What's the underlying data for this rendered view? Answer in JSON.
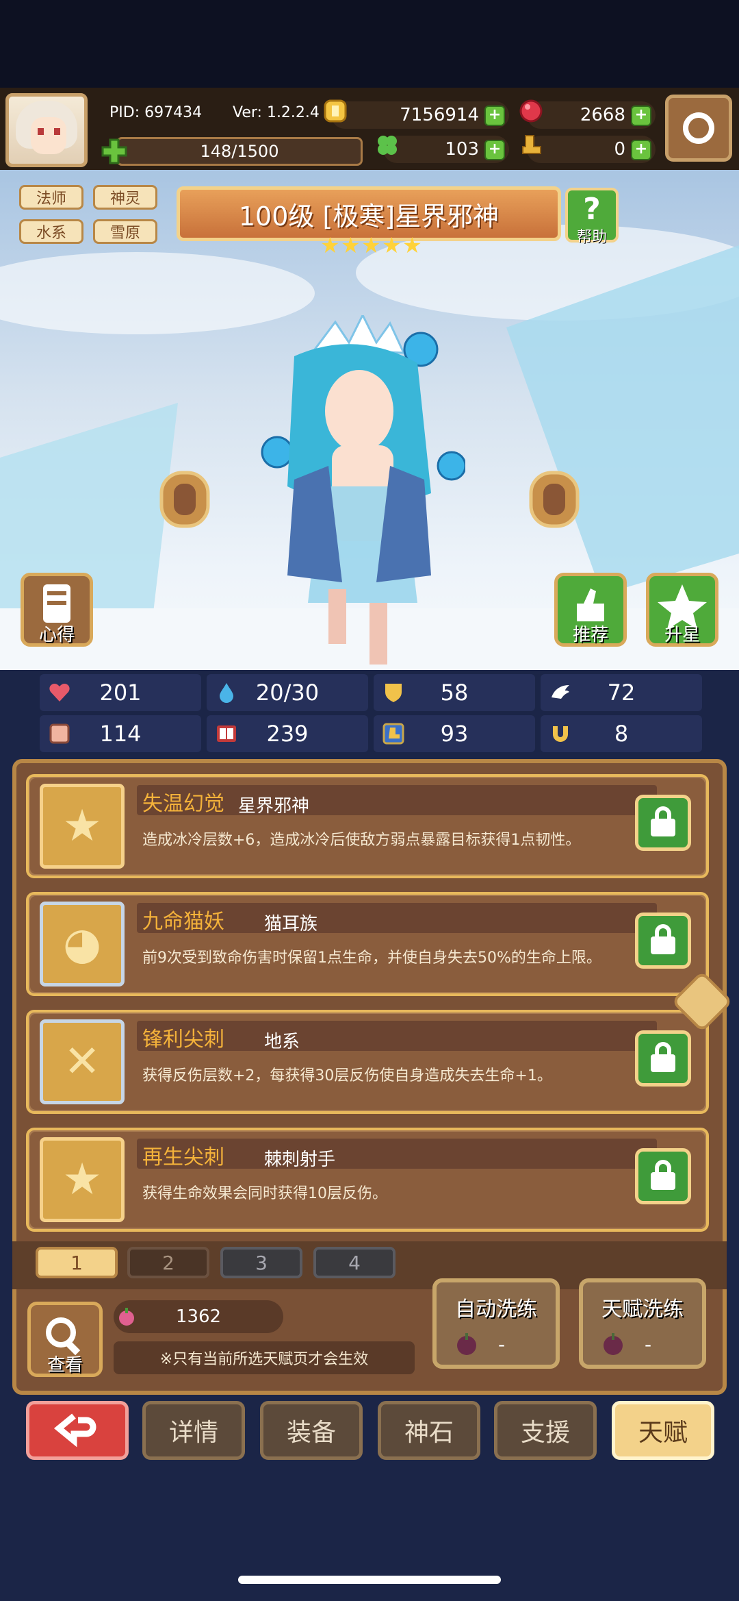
{
  "header": {
    "pid": "PID: 697434",
    "version": "Ver: 1.2.2.4",
    "gold": "7156914",
    "gems": "2668",
    "stamina": "148/1500",
    "clover": "103",
    "boots": "0"
  },
  "hero": {
    "tags": [
      "法师",
      "神灵",
      "水系",
      "雪原"
    ],
    "title": "100级 [极寒]星界邪神",
    "stars": 5,
    "help_label": "帮助",
    "left_button": "心得",
    "recommend_button": "推荐",
    "upgrade_button": "升星"
  },
  "stats": {
    "hp": "201",
    "mana": "20/30",
    "defense": "58",
    "speed": "72",
    "attack": "114",
    "magic": "239",
    "armor": "93",
    "luck": "8"
  },
  "talents": [
    {
      "name": "失温幻觉",
      "source": "星界邪神",
      "desc": "造成冰冷层数+6，造成冰冷后使敌方弱点暴露目标获得1点韧性。",
      "icon": "star-icon"
    },
    {
      "name": "九命猫妖",
      "source": "猫耳族",
      "desc": "前9次受到致命伤害时保留1点生命，并使自身失去50%的生命上限。",
      "icon": "cat-icon"
    },
    {
      "name": "锋利尖刺",
      "source": "地系",
      "desc": "获得反伤层数+2，每获得30层反伤使自身造成失去生命+1。",
      "icon": "spikes-icon"
    },
    {
      "name": "再生尖刺",
      "source": "棘刺射手",
      "desc": "获得生命效果会同时获得10层反伤。",
      "icon": "star-icon"
    }
  ],
  "pages": [
    "1",
    "2",
    "3",
    "4"
  ],
  "footer": {
    "view_label": "查看",
    "fruit_count": "1362",
    "note": "※只有当前所选天赋页才会生效",
    "auto_reroll": "自动洗练",
    "auto_reroll_cost": "-",
    "talent_reroll": "天赋洗练",
    "talent_reroll_cost": "-"
  },
  "nav": {
    "details": "详情",
    "equipment": "装备",
    "godstone": "神石",
    "support": "支援",
    "talent": "天赋"
  },
  "colors": {
    "accent_gold": "#e8b95c",
    "panel_brown": "#7a5136",
    "lock_green": "#3f9b3a",
    "back_red": "#d9423e",
    "active_tab": "#f3d28a"
  }
}
